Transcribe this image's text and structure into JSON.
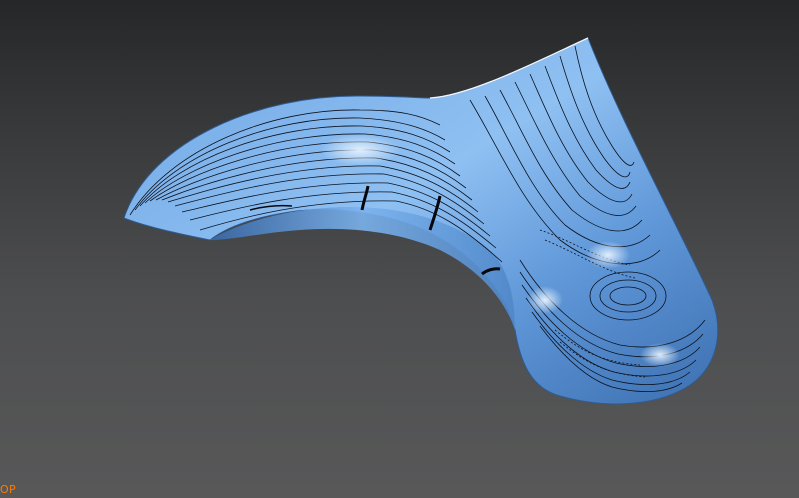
{
  "viewport": {
    "view_label": "OP"
  },
  "colors": {
    "background_top": "#262728",
    "background_bottom": "#585859",
    "surface_base": "#6fa6e3",
    "surface_shadow": "#3c6fb0",
    "surface_highlight": "#cfe6ff",
    "contour_line": "#0b1220",
    "view_label": "#ff7a00"
  },
  "icons": {
    "model": "3d-surface-model"
  }
}
